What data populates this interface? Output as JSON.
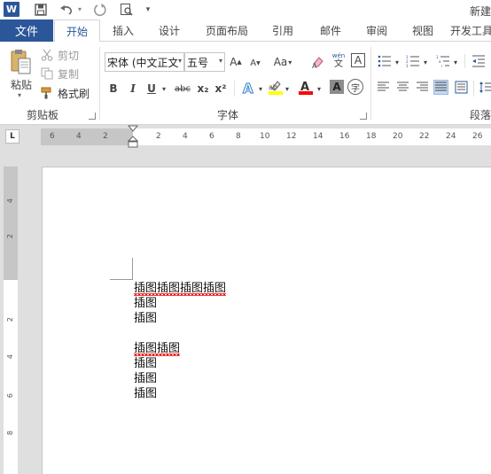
{
  "titlebar": {
    "title": "新建"
  },
  "tabs": {
    "file": "文件",
    "items": [
      "开始",
      "插入",
      "设计",
      "页面布局",
      "引用",
      "邮件",
      "审阅",
      "视图",
      "开发工具"
    ]
  },
  "clipboard": {
    "paste": "粘贴",
    "cut": "剪切",
    "copy": "复制",
    "format_painter": "格式刷",
    "group_label": "剪贴板"
  },
  "font": {
    "font_name": "宋体 (中文正文",
    "font_size": "五号",
    "case_label": "Aa",
    "phonetic_top": "wén",
    "phonetic_bottom": "文",
    "border_char": "A",
    "bold": "B",
    "italic": "I",
    "underline": "U",
    "strike": "abc",
    "subscript": "x₂",
    "superscript": "x²",
    "enclose_char": "字",
    "group_label": "字体"
  },
  "paragraph": {
    "group_label": "段落"
  },
  "colors": {
    "accent": "#2b579a",
    "highlight": "#ffff00",
    "font_color": "#ff0000"
  },
  "hruler": {
    "ticks": [
      "6",
      "4",
      "2",
      "2",
      "4",
      "6",
      "8",
      "10",
      "12",
      "14",
      "16",
      "18",
      "20",
      "22",
      "24",
      "26"
    ]
  },
  "vruler": {
    "ticks": [
      "4",
      "2",
      "2",
      "4",
      "6",
      "8"
    ]
  },
  "document": {
    "lines": [
      "插图插图插图插图",
      "插图",
      "插图",
      "",
      "插图插图",
      "插图",
      "插图",
      "插图"
    ]
  }
}
